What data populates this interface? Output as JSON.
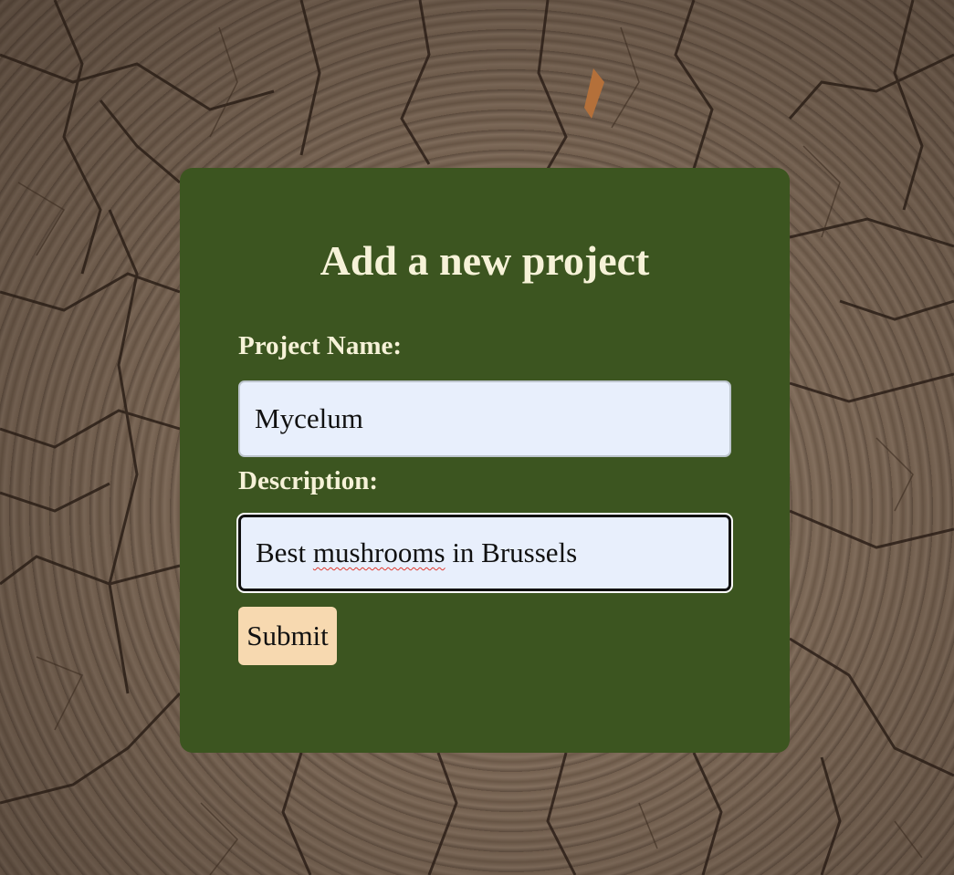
{
  "form": {
    "title": "Add a new project",
    "project_name_label": "Project Name:",
    "project_name_value": "Mycelum",
    "description_label": "Description:",
    "description_value_part1": "Best ",
    "description_value_misspelled": "mushrooms",
    "description_value_part2": " in Brussels",
    "submit_label": "Submit"
  },
  "colors": {
    "card_background": "#3c5520",
    "label_text": "#f6f2d8",
    "input_background": "#e8effc",
    "submit_background": "#f7d9b0",
    "spellcheck_underline": "#e0392f"
  },
  "background": {
    "description_icon": "tree-stump-wood-texture"
  }
}
